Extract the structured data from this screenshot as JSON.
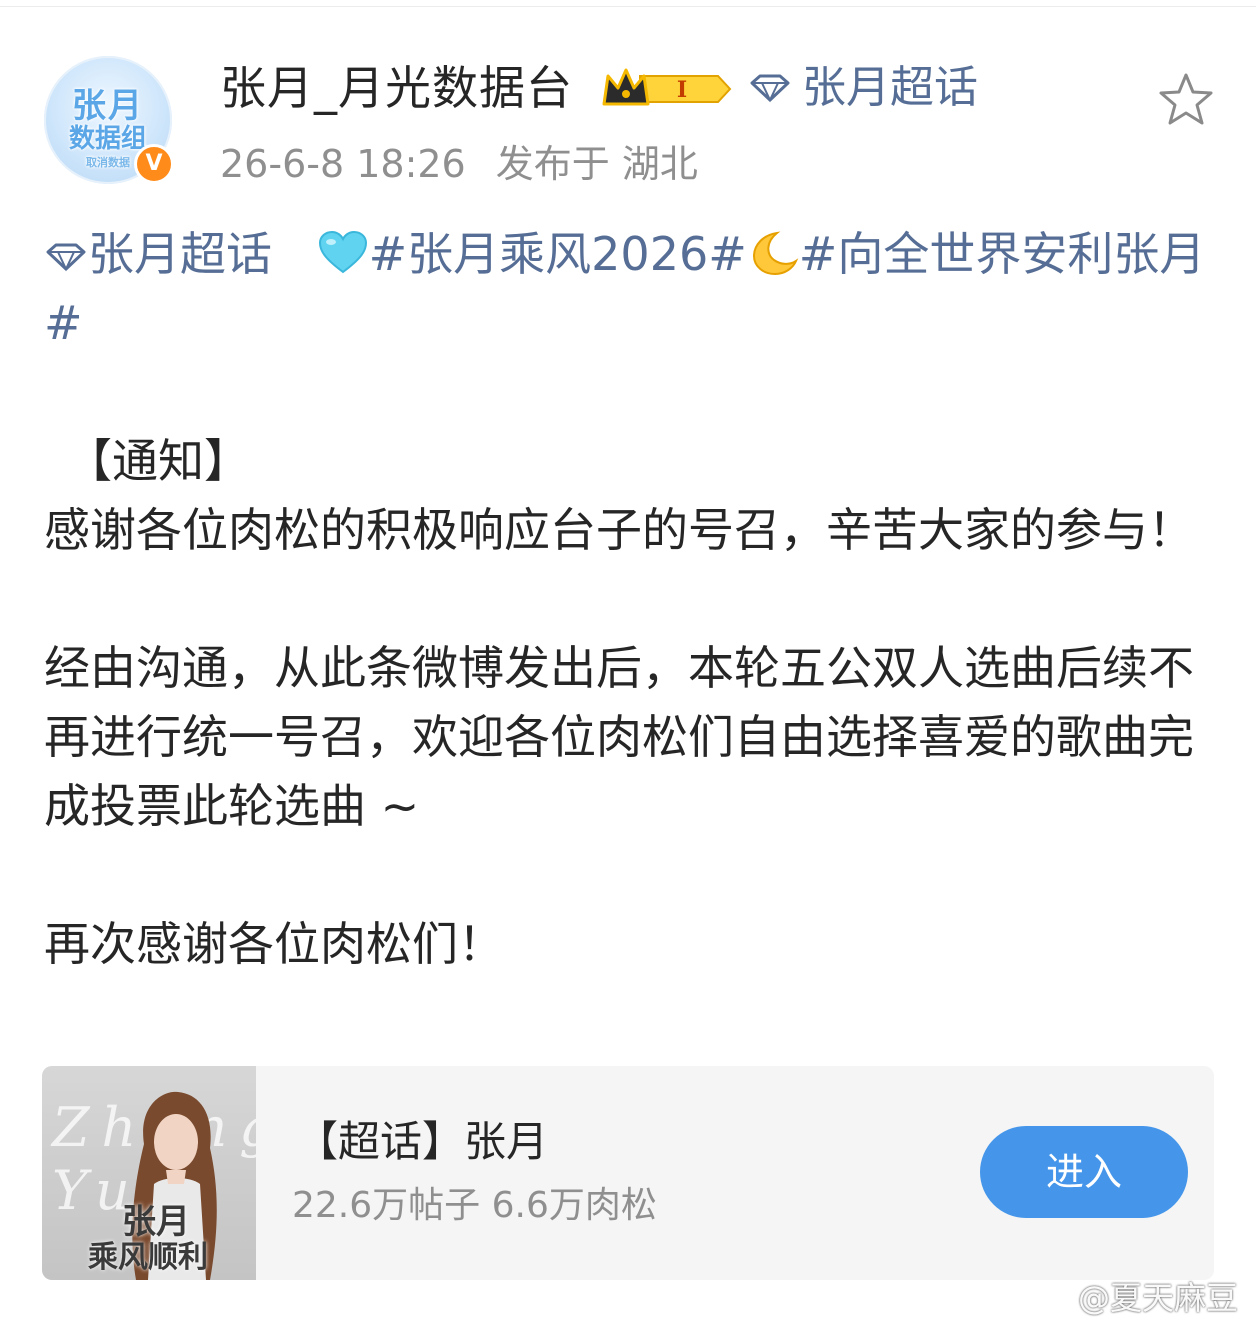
{
  "author": {
    "name": "张月_月光数据台",
    "avatar_text": [
      "张月",
      "数据组",
      "取消数据"
    ],
    "crown_level": "I",
    "supertopic": "张月超话",
    "time": "26-6-8 18:26",
    "location": "发布于 湖北"
  },
  "post": {
    "tag_supertopic": "张月超话",
    "tag_1": "#张月乘风2026#",
    "tag_2": "#向全世界安利张月#",
    "notice": "【通知】",
    "para_1": "感谢各位肉松的积极响应台子的号召，辛苦大家的参与！",
    "para_2": "经由沟通，从此条微博发出后，本轮五公双人选曲后续不再进行统一号召，欢迎各位肉松们自由选择喜爱的歌曲完成投票此轮选曲 ~",
    "para_3": "再次感谢各位肉松们！"
  },
  "card": {
    "thumb_script": "Zhang Yue",
    "thumb_title_1": "张月",
    "thumb_title_2": "乘风顺利",
    "title": "【超话】张月",
    "stats": "22.6万帖子 6.6万肉松",
    "enter_label": "进入"
  },
  "watermark": "@夏天麻豆",
  "colors": {
    "link": "#566e95",
    "accent_button": "#4596ea",
    "verified": "#ff8b1a",
    "meta_text": "#8f8f8f"
  },
  "icons": {
    "star": "star-outline-icon",
    "gem": "diamond-icon",
    "heart": "light-blue-heart-emoji",
    "moon": "crescent-moon-emoji"
  }
}
